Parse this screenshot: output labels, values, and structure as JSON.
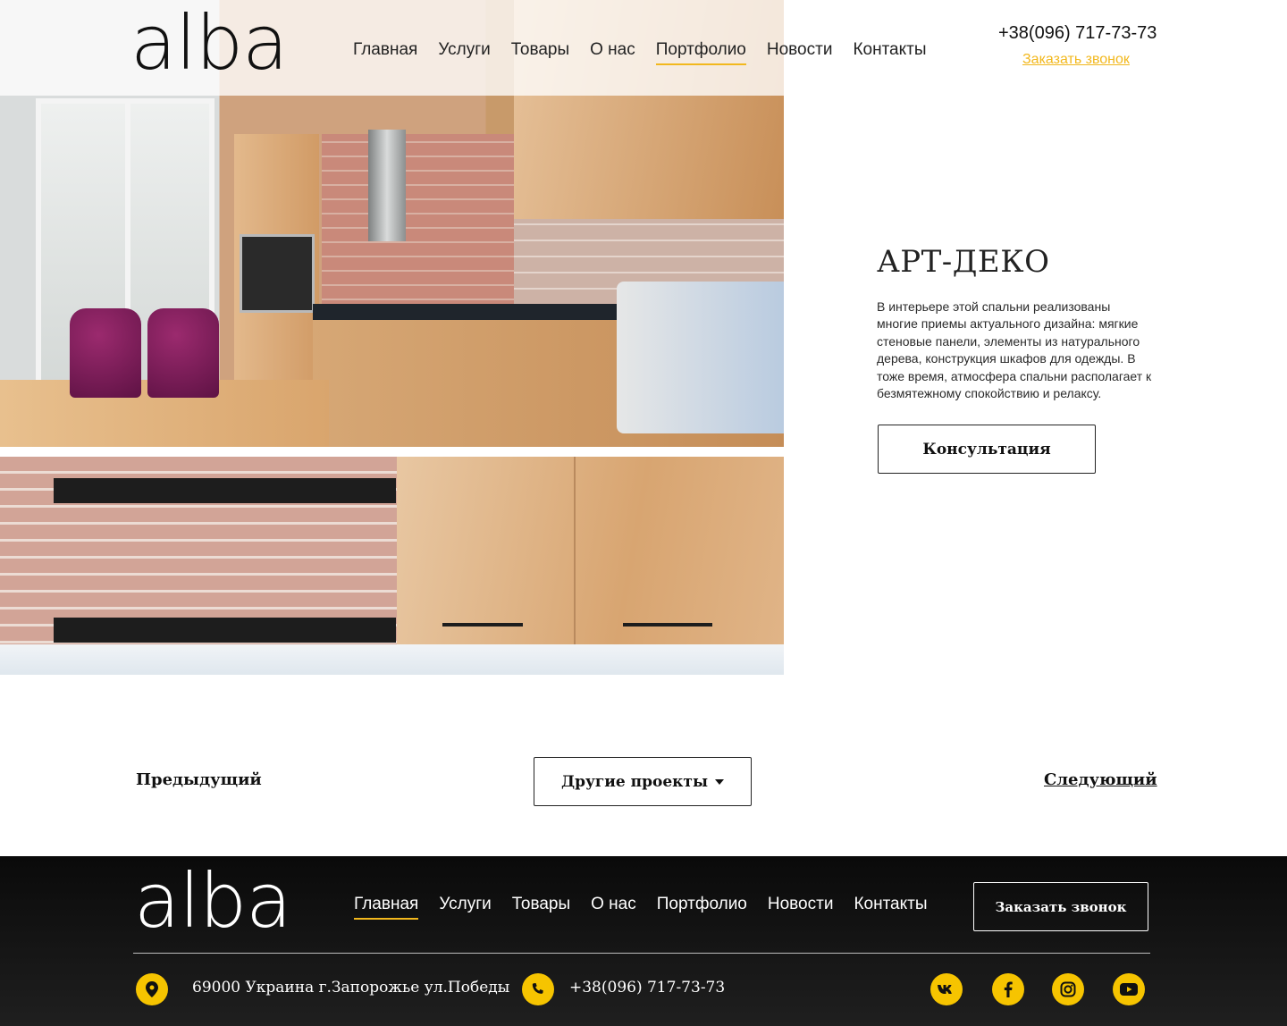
{
  "brand": {
    "logo_text": "alba"
  },
  "nav": {
    "items": [
      "Главная",
      "Услуги",
      "Товары",
      "О нас",
      "Портфолио",
      "Новости",
      "Контакты"
    ]
  },
  "header": {
    "phone": "+38(096) 717-73-73",
    "callback_link": "Заказать звонок"
  },
  "project": {
    "title": "АРТ-ДЕКО",
    "description": "В интерьере этой спальни реализованы многие приемы актуального дизайна: мягкие стеновые панели, элементы из натурального дерева, конструкция шкафов для одежды. В тоже время, атмосфера спальни располагает к безмятежному спокойствию и релаксу.",
    "consult_button": "Консультация"
  },
  "pagination": {
    "prev": "Предыдущий",
    "other_projects": "Другие проекты",
    "next": "Следующий"
  },
  "footer": {
    "callback_button": "Заказать звонок",
    "address": "69000 Украина г.Запорожье ул.Победы",
    "phone": "+38(096) 717-73-73",
    "social": [
      "vk-icon",
      "facebook-icon",
      "instagram-icon",
      "youtube-icon"
    ]
  },
  "colors": {
    "accent": "#f2b81d",
    "footer_bg": "#111111"
  }
}
